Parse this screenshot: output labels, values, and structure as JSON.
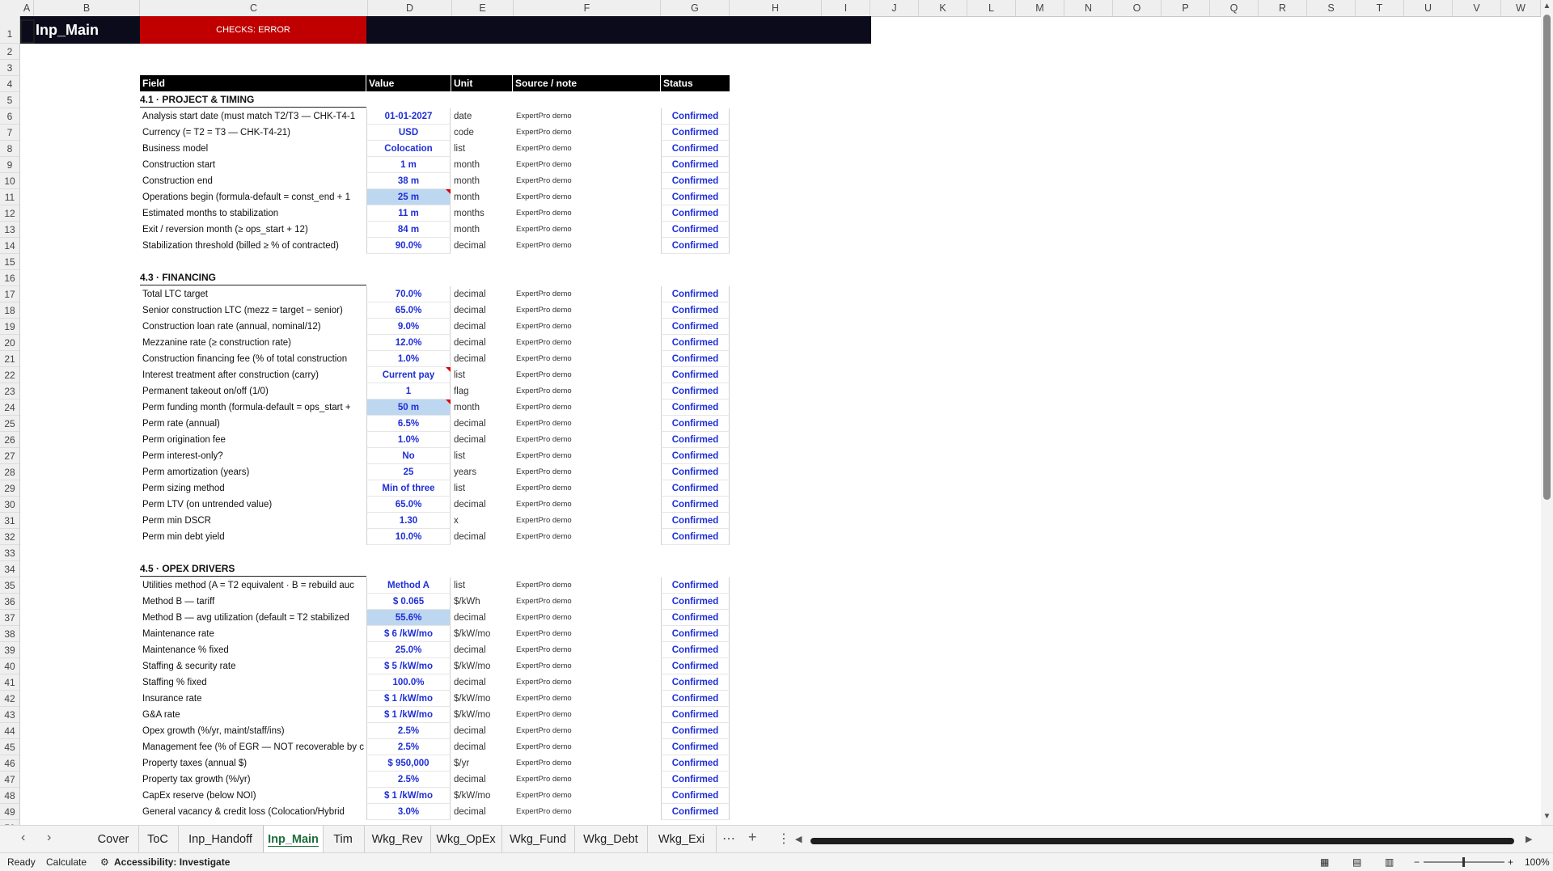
{
  "sheet_title": "Inp_Main",
  "checks": "CHECKS: ERROR",
  "columns": [
    "A",
    "B",
    "C",
    "D",
    "E",
    "F",
    "G",
    "H",
    "I",
    "J",
    "K",
    "L",
    "M",
    "N",
    "O",
    "P",
    "Q",
    "R",
    "S",
    "T",
    "U",
    "V",
    "W"
  ],
  "table_headers": {
    "field": "Field",
    "value": "Value",
    "unit": "Unit",
    "source": "Source / note",
    "status": "Status"
  },
  "sections": {
    "s1": "4.1 · PROJECT & TIMING",
    "s2": "4.3 · FINANCING",
    "s3": "4.5 · OPEX DRIVERS"
  },
  "rows": [
    {
      "field": "Analysis start date (must match T2/T3 — CHK-T4-1",
      "value": "01-01-2027",
      "unit": "date",
      "source": "ExpertPro demo",
      "status": "Confirmed"
    },
    {
      "field": "Currency (= T2 = T3 — CHK-T4-21)",
      "value": "USD",
      "unit": "code",
      "source": "ExpertPro demo",
      "status": "Confirmed"
    },
    {
      "field": "Business model",
      "value": "Colocation",
      "unit": "list",
      "source": "ExpertPro demo",
      "status": "Confirmed"
    },
    {
      "field": "Construction start",
      "value": "1 m",
      "unit": "month",
      "source": "ExpertPro demo",
      "status": "Confirmed"
    },
    {
      "field": "Construction end",
      "value": "38 m",
      "unit": "month",
      "source": "ExpertPro demo",
      "status": "Confirmed"
    },
    {
      "field": "Operations begin (formula-default = const_end + 1",
      "value": "25 m",
      "unit": "month",
      "source": "ExpertPro demo",
      "status": "Confirmed"
    },
    {
      "field": "Estimated months to stabilization",
      "value": "11 m",
      "unit": "months",
      "source": "ExpertPro demo",
      "status": "Confirmed"
    },
    {
      "field": "Exit / reversion month (≥ ops_start + 12)",
      "value": "84 m",
      "unit": "month",
      "source": "ExpertPro demo",
      "status": "Confirmed"
    },
    {
      "field": "Stabilization threshold (billed ≥ % of contracted)",
      "value": "90.0%",
      "unit": "decimal",
      "source": "ExpertPro demo",
      "status": "Confirmed"
    },
    {
      "field": "Total LTC target",
      "value": "70.0%",
      "unit": "decimal",
      "source": "ExpertPro demo",
      "status": "Confirmed"
    },
    {
      "field": "Senior construction LTC (mezz = target − senior)",
      "value": "65.0%",
      "unit": "decimal",
      "source": "ExpertPro demo",
      "status": "Confirmed"
    },
    {
      "field": "Construction loan rate (annual, nominal/12)",
      "value": "9.0%",
      "unit": "decimal",
      "source": "ExpertPro demo",
      "status": "Confirmed"
    },
    {
      "field": "Mezzanine rate (≥ construction rate)",
      "value": "12.0%",
      "unit": "decimal",
      "source": "ExpertPro demo",
      "status": "Confirmed"
    },
    {
      "field": "Construction financing fee (% of total construction",
      "value": "1.0%",
      "unit": "decimal",
      "source": "ExpertPro demo",
      "status": "Confirmed"
    },
    {
      "field": "Interest treatment after construction (carry)",
      "value": "Current pay",
      "unit": "list",
      "source": "ExpertPro demo",
      "status": "Confirmed"
    },
    {
      "field": "Permanent takeout on/off (1/0)",
      "value": "1",
      "unit": "flag",
      "source": "ExpertPro demo",
      "status": "Confirmed"
    },
    {
      "field": "Perm funding month (formula-default = ops_start +",
      "value": "50 m",
      "unit": "month",
      "source": "ExpertPro demo",
      "status": "Confirmed"
    },
    {
      "field": "Perm rate (annual)",
      "value": "6.5%",
      "unit": "decimal",
      "source": "ExpertPro demo",
      "status": "Confirmed"
    },
    {
      "field": "Perm origination fee",
      "value": "1.0%",
      "unit": "decimal",
      "source": "ExpertPro demo",
      "status": "Confirmed"
    },
    {
      "field": "Perm interest-only?",
      "value": "No",
      "unit": "list",
      "source": "ExpertPro demo",
      "status": "Confirmed"
    },
    {
      "field": "Perm amortization (years)",
      "value": "25",
      "unit": "years",
      "source": "ExpertPro demo",
      "status": "Confirmed"
    },
    {
      "field": "Perm sizing method",
      "value": "Min of three",
      "unit": "list",
      "source": "ExpertPro demo",
      "status": "Confirmed"
    },
    {
      "field": "Perm LTV (on untrended value)",
      "value": "65.0%",
      "unit": "decimal",
      "source": "ExpertPro demo",
      "status": "Confirmed"
    },
    {
      "field": "Perm min DSCR",
      "value": "1.30",
      "unit": "x",
      "source": "ExpertPro demo",
      "status": "Confirmed"
    },
    {
      "field": "Perm min debt yield",
      "value": "10.0%",
      "unit": "decimal",
      "source": "ExpertPro demo",
      "status": "Confirmed"
    },
    {
      "field": "Utilities method (A = T2 equivalent · B = rebuild auc",
      "value": "Method A",
      "unit": "list",
      "source": "ExpertPro demo",
      "status": "Confirmed"
    },
    {
      "field": "Method B — tariff",
      "value": "$ 0.065",
      "unit": "$/kWh",
      "source": "ExpertPro demo",
      "status": "Confirmed"
    },
    {
      "field": "Method B — avg utilization (default = T2 stabilized",
      "value": "55.6%",
      "unit": "decimal",
      "source": "ExpertPro demo",
      "status": "Confirmed"
    },
    {
      "field": "Maintenance rate",
      "value": "$ 6 /kW/mo",
      "unit": "$/kW/mo",
      "source": "ExpertPro demo",
      "status": "Confirmed"
    },
    {
      "field": "Maintenance % fixed",
      "value": "25.0%",
      "unit": "decimal",
      "source": "ExpertPro demo",
      "status": "Confirmed"
    },
    {
      "field": "Staffing & security rate",
      "value": "$ 5 /kW/mo",
      "unit": "$/kW/mo",
      "source": "ExpertPro demo",
      "status": "Confirmed"
    },
    {
      "field": "Staffing % fixed",
      "value": "100.0%",
      "unit": "decimal",
      "source": "ExpertPro demo",
      "status": "Confirmed"
    },
    {
      "field": "Insurance rate",
      "value": "$ 1 /kW/mo",
      "unit": "$/kW/mo",
      "source": "ExpertPro demo",
      "status": "Confirmed"
    },
    {
      "field": "G&A rate",
      "value": "$ 1 /kW/mo",
      "unit": "$/kW/mo",
      "source": "ExpertPro demo",
      "status": "Confirmed"
    },
    {
      "field": "Opex growth (%/yr, maint/staff/ins)",
      "value": "2.5%",
      "unit": "decimal",
      "source": "ExpertPro demo",
      "status": "Confirmed"
    },
    {
      "field": "Management fee (% of EGR — NOT recoverable by c",
      "value": "2.5%",
      "unit": "decimal",
      "source": "ExpertPro demo",
      "status": "Confirmed"
    },
    {
      "field": "Property taxes (annual $)",
      "value": "$ 950,000",
      "unit": "$/yr",
      "source": "ExpertPro demo",
      "status": "Confirmed"
    },
    {
      "field": "Property tax growth (%/yr)",
      "value": "2.5%",
      "unit": "decimal",
      "source": "ExpertPro demo",
      "status": "Confirmed"
    },
    {
      "field": "CapEx reserve (below NOI)",
      "value": "$ 1 /kW/mo",
      "unit": "$/kW/mo",
      "source": "ExpertPro demo",
      "status": "Confirmed"
    },
    {
      "field": "General vacancy & credit loss (Colocation/Hybrid",
      "value": "3.0%",
      "unit": "decimal",
      "source": "ExpertPro demo",
      "status": "Confirmed"
    }
  ],
  "tabs": [
    "Cover",
    "ToC",
    "Inp_Handoff",
    "Inp_Main",
    "Tim",
    "Wkg_Rev",
    "Wkg_OpEx",
    "Wkg_Fund",
    "Wkg_Debt",
    "Wkg_Exi"
  ],
  "active_tab": "Inp_Main",
  "statusbar": {
    "ready": "Ready",
    "calculate": "Calculate",
    "accessibility": "Accessibility: Investigate",
    "zoom": "100%"
  }
}
